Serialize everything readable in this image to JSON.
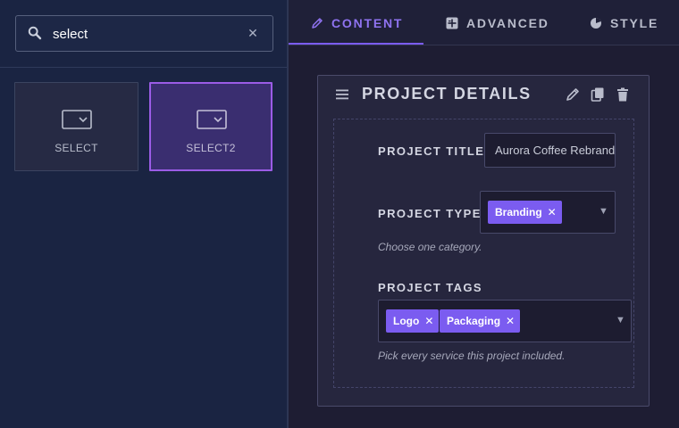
{
  "search": {
    "value": "select",
    "clear_label": "✕"
  },
  "widgets": [
    {
      "label": "SELECT",
      "icon": "dropdown-select-icon"
    },
    {
      "label": "SELECT2",
      "icon": "dropdown-select-icon",
      "selected": true
    }
  ],
  "tabs": [
    {
      "label": "CONTENT",
      "icon": "pencil-icon",
      "active": true
    },
    {
      "label": "ADVANCED",
      "icon": "advanced-grid-icon"
    },
    {
      "label": "STYLE",
      "icon": "palette-icon"
    }
  ],
  "section": {
    "title": "PROJECT DETAILS",
    "fields": {
      "title": {
        "label": "PROJECT TITLE",
        "value": "Aurora Coffee Rebrand"
      },
      "type": {
        "label": "PROJECT TYPE",
        "chips": [
          "Branding"
        ],
        "help": "Choose one category."
      },
      "tags": {
        "label": "PROJECT TAGS",
        "chips": [
          "Logo",
          "Packaging"
        ],
        "help": "Pick every service this project included."
      }
    }
  },
  "glyphs": {
    "chip_remove": "✕",
    "dropdown_arrow": "▼"
  },
  "colors": {
    "accent": "#7b5cf0",
    "selected_border": "#9b5ce6",
    "left_bg": "#1a2442",
    "right_bg": "#1e1d33"
  }
}
